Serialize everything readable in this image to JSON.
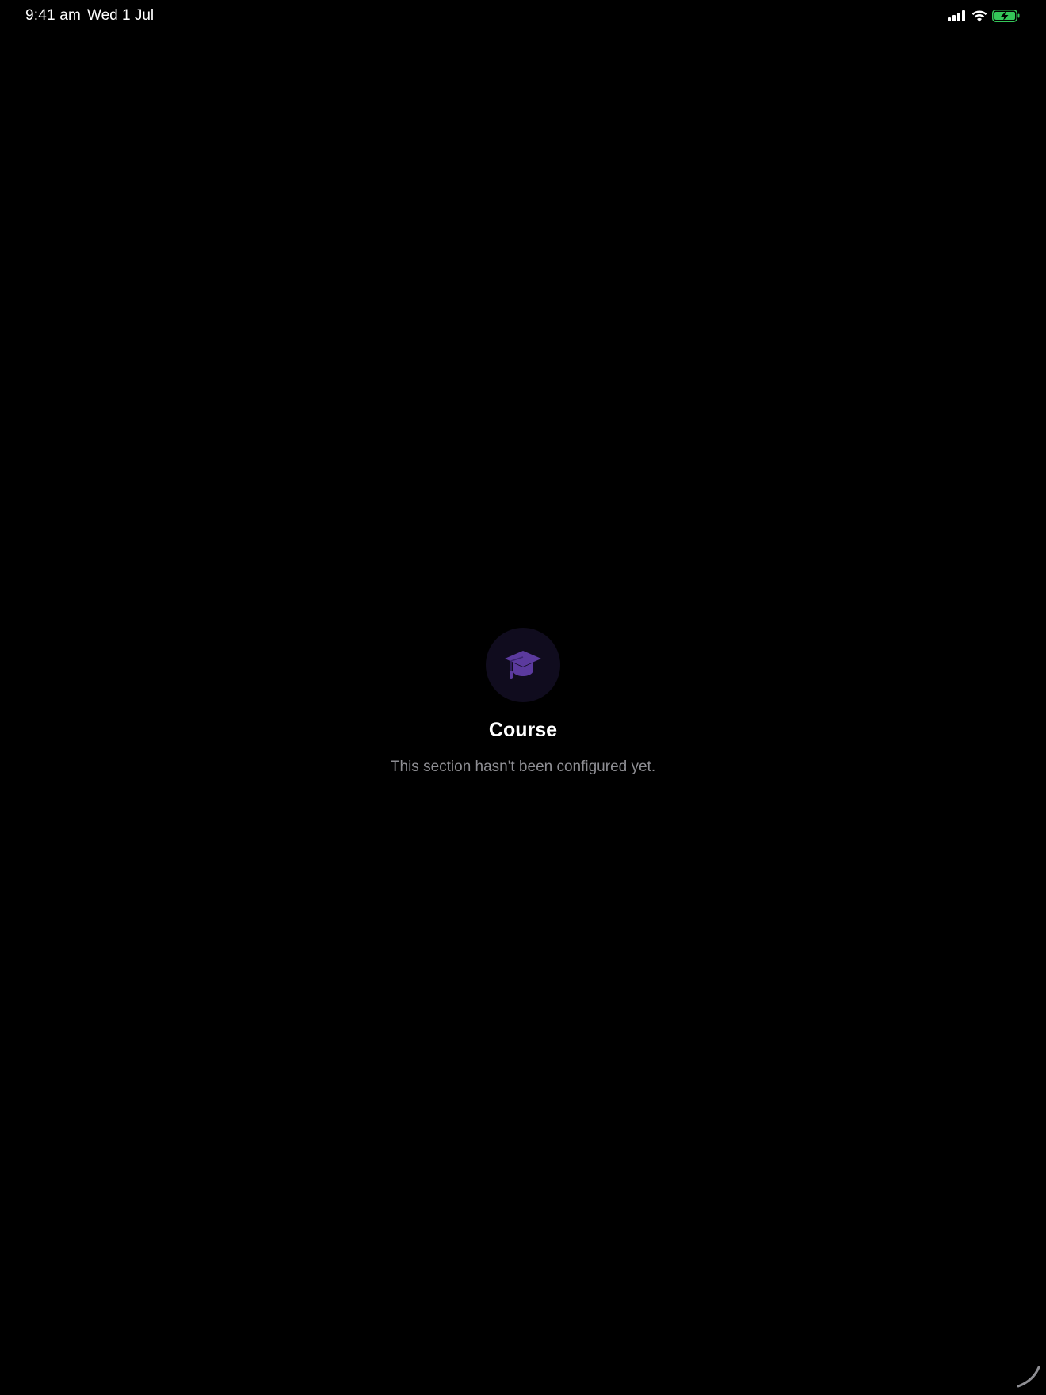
{
  "status_bar": {
    "time": "9:41 am",
    "date": "Wed 1 Jul",
    "signal_icon": "cellular-signal-icon",
    "wifi_icon": "wifi-icon",
    "battery_icon": "battery-charging-icon",
    "battery_color": "#34c759"
  },
  "empty_state": {
    "icon": "graduation-cap-icon",
    "icon_color": "#5b3a9e",
    "icon_bg": "#100c1e",
    "title": "Course",
    "subtitle": "This section hasn't been configured yet."
  },
  "loading_indicator": {
    "icon": "spinner-arc-icon"
  }
}
